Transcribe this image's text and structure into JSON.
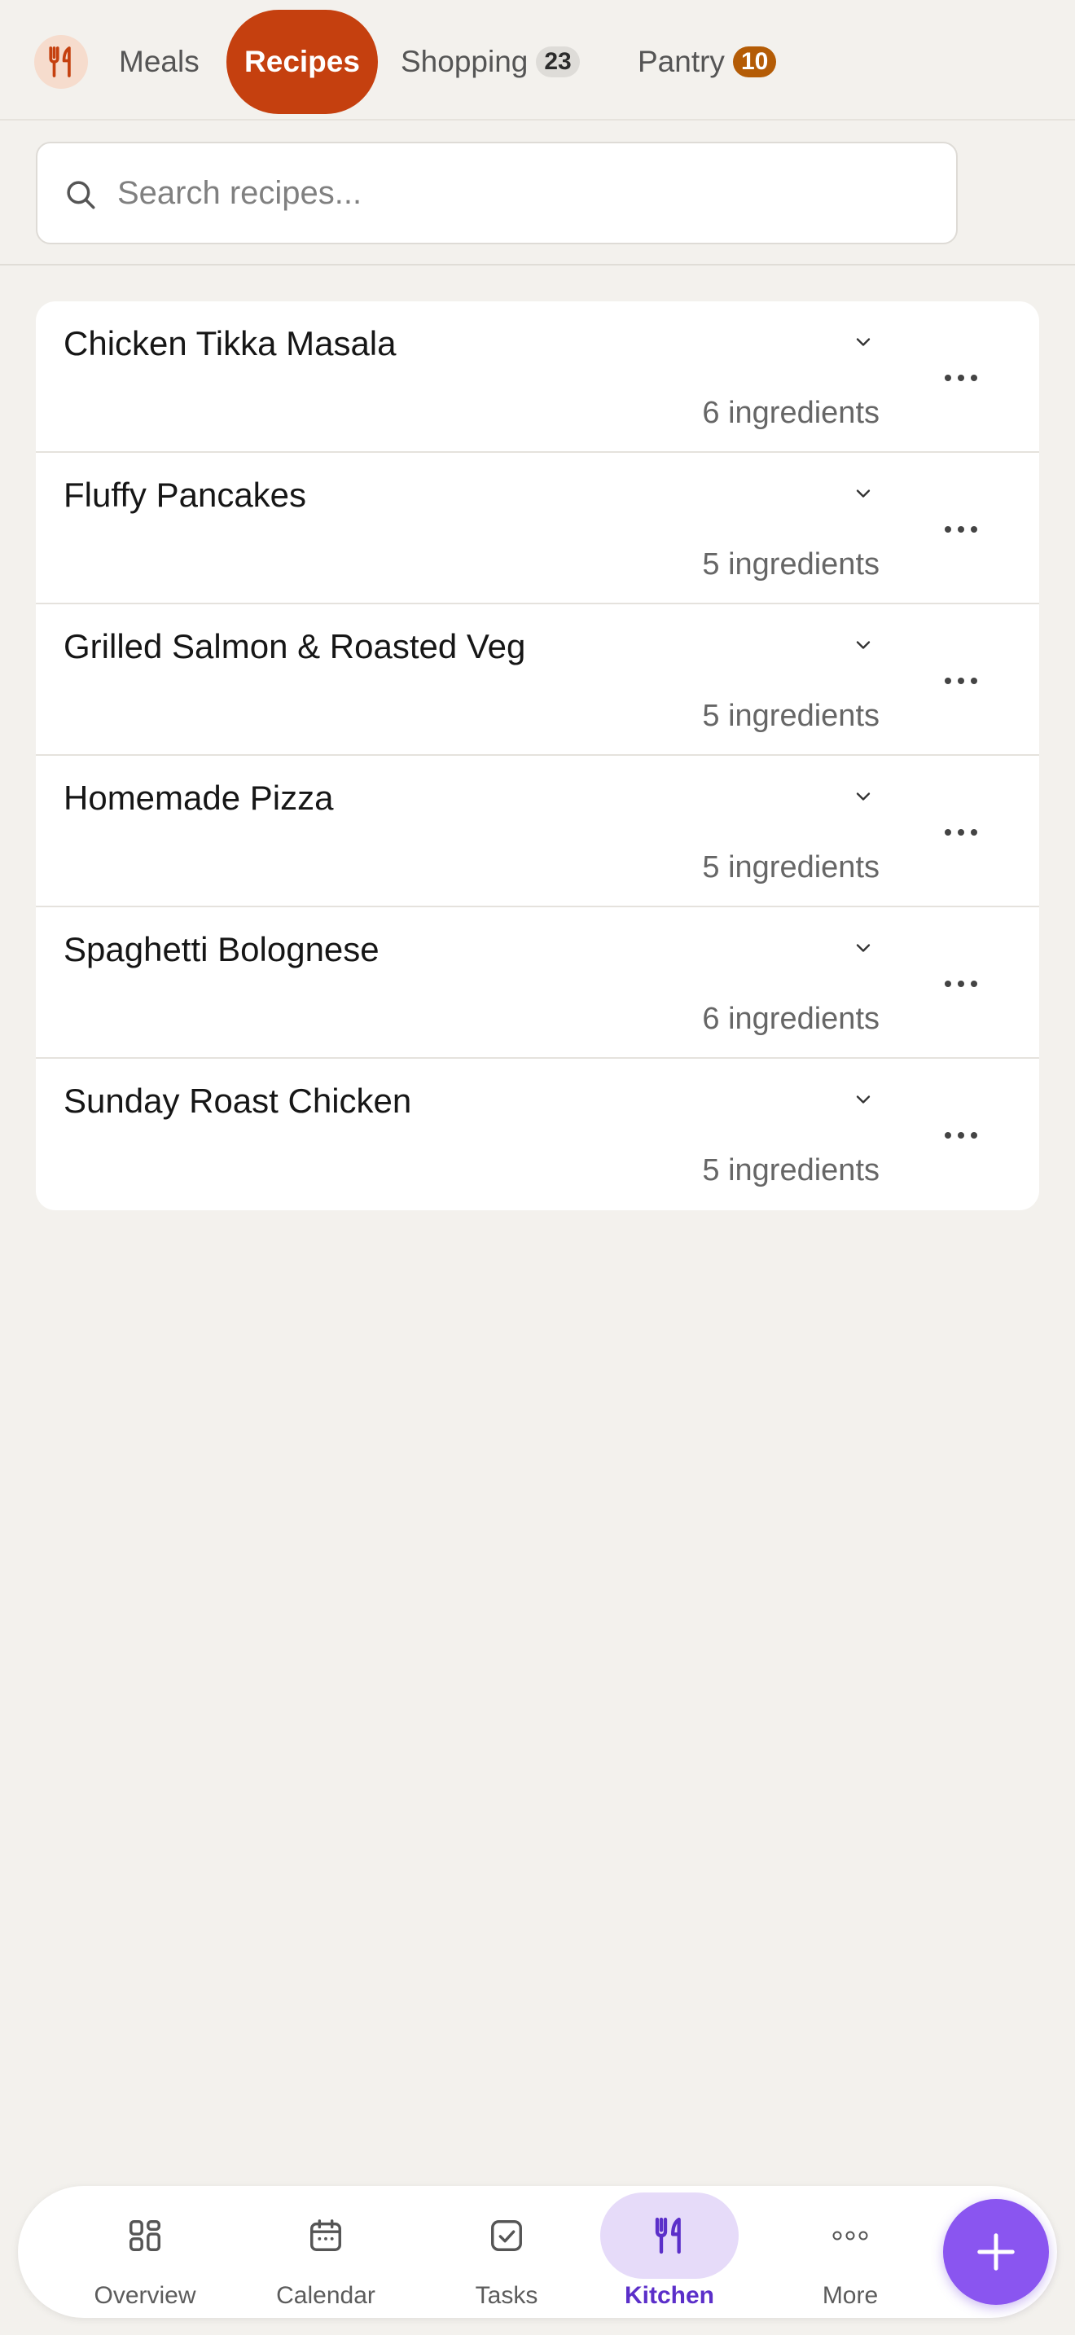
{
  "top_tabs": {
    "meals": "Meals",
    "recipes": "Recipes",
    "shopping": "Shopping",
    "shopping_count": "23",
    "pantry": "Pantry",
    "pantry_count": "10",
    "active": "Recipes"
  },
  "search": {
    "placeholder": "Search recipes...",
    "value": ""
  },
  "recipes": [
    {
      "name": "Chicken Tikka Masala",
      "ingredients": "6 ingredients"
    },
    {
      "name": "Fluffy Pancakes",
      "ingredients": "5 ingredients"
    },
    {
      "name": "Grilled Salmon & Roasted Veg",
      "ingredients": "5 ingredients"
    },
    {
      "name": "Homemade Pizza",
      "ingredients": "5 ingredients"
    },
    {
      "name": "Spaghetti Bolognese",
      "ingredients": "6 ingredients"
    },
    {
      "name": "Sunday Roast Chicken",
      "ingredients": "5 ingredients"
    }
  ],
  "bottom_nav": {
    "overview": "Overview",
    "calendar": "Calendar",
    "tasks": "Tasks",
    "kitchen": "Kitchen",
    "more": "More",
    "active": "Kitchen"
  },
  "icons": {
    "logo": "fork-knife-icon",
    "search": "search-icon",
    "expand": "chevron-down-icon",
    "row_menu": "more-horizontal-icon",
    "overview": "grid-icon",
    "calendar": "calendar-icon",
    "tasks": "check-square-icon",
    "kitchen": "fork-knife-icon",
    "more": "more-horizontal-icon",
    "fab": "plus-icon"
  },
  "colors": {
    "accent_recipes": "#c5400f",
    "pantry_badge": "#b45c06",
    "kitchen_active": "#5b2fc9",
    "fab": "#8a55f0",
    "background": "#f3f1ed"
  }
}
